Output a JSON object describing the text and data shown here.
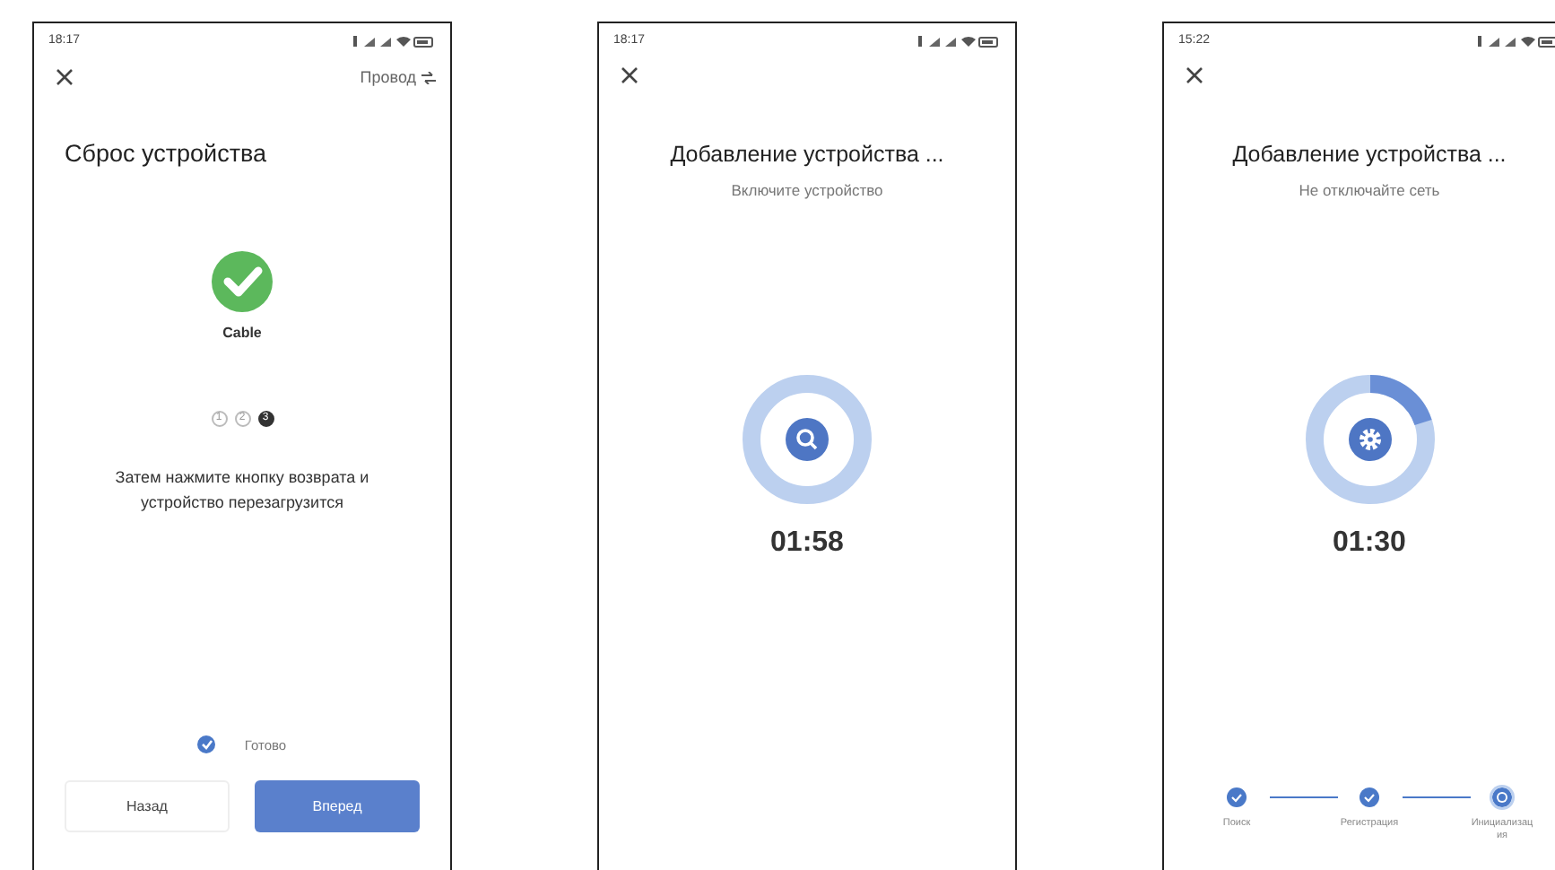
{
  "screens": [
    {
      "kind": "reset",
      "status_time": "18:17",
      "link": "Провод",
      "title": "Сброс устройства",
      "device_label": "Cable",
      "pages": [
        {
          "label": "1",
          "selected": false
        },
        {
          "label": "2",
          "selected": false
        },
        {
          "label": "3",
          "selected": true
        }
      ],
      "instruction": "Затем нажмите кнопку возврата и устройство перезагрузится",
      "confirm": {
        "label": "Готово",
        "checked": true
      },
      "buttons": [
        {
          "label": "Назад",
          "kind": "secondary"
        },
        {
          "label": "Вперед",
          "kind": "primary"
        }
      ]
    },
    {
      "kind": "progress",
      "status_time": "18:17",
      "title": "Добавление устройства ...",
      "subtitle": "Включите устройство",
      "level": 0,
      "timer": "01:58"
    },
    {
      "kind": "progress",
      "status_time": "15:22",
      "title": "Добавление устройства ...",
      "subtitle": "Не отключайте сеть",
      "level": 0.2,
      "timer": "01:30",
      "steps": [
        {
          "label": "Поиск",
          "done": true,
          "selected": false
        },
        {
          "label": "Регистрация",
          "done": true,
          "selected": false
        },
        {
          "label": "Инициализация",
          "done": false,
          "selected": true
        }
      ]
    }
  ]
}
